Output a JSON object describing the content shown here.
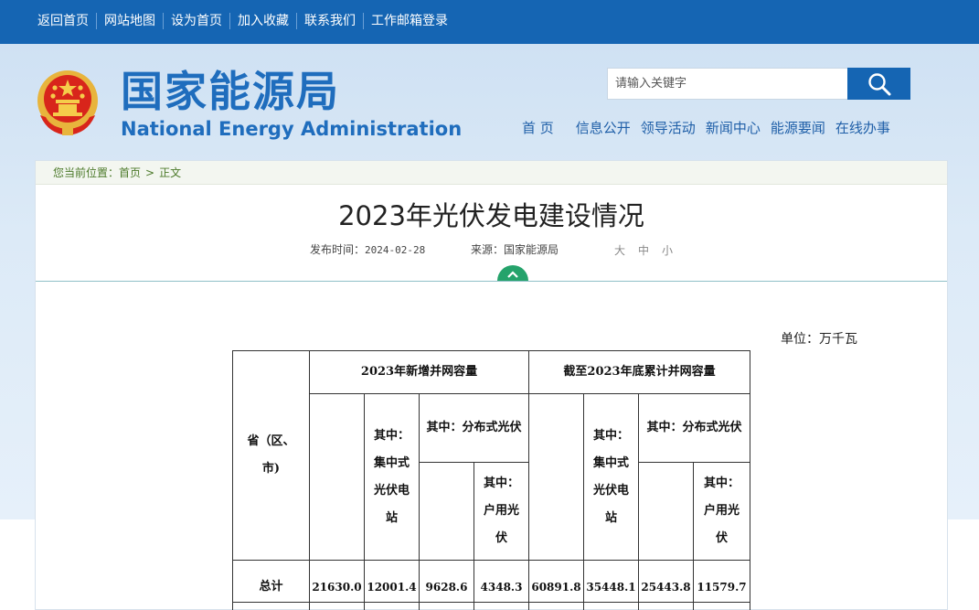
{
  "topbar": {
    "links": [
      "返回首页",
      "网站地图",
      "设为首页",
      "加入收藏",
      "联系我们",
      "工作邮箱登录"
    ]
  },
  "header": {
    "logo_cn": "国家能源局",
    "logo_en": "National Energy Administration",
    "search_placeholder": "请输入关键字",
    "nav": [
      "首 页",
      "信息公开",
      "领导活动",
      "新闻中心",
      "能源要闻",
      "在线办事"
    ]
  },
  "breadcrumb": {
    "label": "您当前位置：",
    "home": "首页",
    "sep": ">",
    "current": "正文"
  },
  "article": {
    "title": "2023年光伏发电建设情况",
    "published_label": "发布时间：",
    "published_date": "2024-02-28",
    "source_label": "来源：",
    "source": "国家能源局",
    "font_sizes": [
      "大",
      "中",
      "小"
    ]
  },
  "table": {
    "unit": "单位：万千瓦",
    "col_region": "省（区、市)",
    "group_new": "2023年新增并网容量",
    "group_cum": "截至2023年底累计并网容量",
    "col_central": "其中：集中式光伏电站",
    "col_distributed": "其中：分布式光伏",
    "col_household": "其中：户用光伏",
    "total_row": {
      "label": "总计",
      "values": [
        "21630.0",
        "12001.4",
        "9628.6",
        "4348.3",
        "60891.8",
        "35448.1",
        "25443.8",
        "11579.7"
      ]
    }
  },
  "colors": {
    "topbar": "#1565b3",
    "brand": "#1f6dbd",
    "breadcrumb_text": "#4c7a2a",
    "toggle": "#25a36b"
  }
}
